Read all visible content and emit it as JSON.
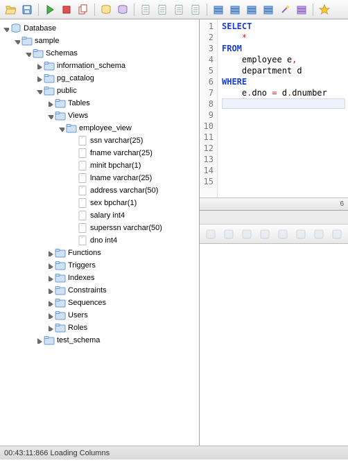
{
  "toolbar": {
    "icons": [
      "folder-open",
      "save",
      "sep",
      "run-green",
      "stop-red",
      "copy-red",
      "sep",
      "db-yellow",
      "db-purple",
      "sep",
      "page",
      "page-copy",
      "page-grid",
      "page-lines",
      "sep",
      "stack-blue",
      "menu-blue",
      "rows-blue",
      "rows-blue2",
      "wand",
      "rows-purple",
      "sep",
      "star"
    ]
  },
  "tree": [
    {
      "d": 0,
      "tw": "open",
      "ic": "db",
      "label": "Database"
    },
    {
      "d": 1,
      "tw": "open",
      "ic": "folder",
      "label": "sample"
    },
    {
      "d": 2,
      "tw": "open",
      "ic": "folder",
      "label": "Schemas"
    },
    {
      "d": 3,
      "tw": "closed",
      "ic": "folder",
      "label": "information_schema"
    },
    {
      "d": 3,
      "tw": "closed",
      "ic": "folder",
      "label": "pg_catalog"
    },
    {
      "d": 3,
      "tw": "open",
      "ic": "folder",
      "label": "public"
    },
    {
      "d": 4,
      "tw": "closed",
      "ic": "folder",
      "label": "Tables"
    },
    {
      "d": 4,
      "tw": "open",
      "ic": "folder",
      "label": "Views"
    },
    {
      "d": 5,
      "tw": "open",
      "ic": "folder",
      "label": "employee_view"
    },
    {
      "d": 6,
      "tw": "none",
      "ic": "col",
      "label": "ssn varchar(25)"
    },
    {
      "d": 6,
      "tw": "none",
      "ic": "col",
      "label": "fname varchar(25)"
    },
    {
      "d": 6,
      "tw": "none",
      "ic": "col",
      "label": "minit bpchar(1)"
    },
    {
      "d": 6,
      "tw": "none",
      "ic": "col",
      "label": "lname varchar(25)"
    },
    {
      "d": 6,
      "tw": "none",
      "ic": "col",
      "label": "address varchar(50)"
    },
    {
      "d": 6,
      "tw": "none",
      "ic": "col",
      "label": "sex bpchar(1)"
    },
    {
      "d": 6,
      "tw": "none",
      "ic": "col",
      "label": "salary int4"
    },
    {
      "d": 6,
      "tw": "none",
      "ic": "col",
      "label": "superssn varchar(50)"
    },
    {
      "d": 6,
      "tw": "none",
      "ic": "col",
      "label": "dno int4"
    },
    {
      "d": 4,
      "tw": "closed",
      "ic": "folder",
      "label": "Functions"
    },
    {
      "d": 4,
      "tw": "closed",
      "ic": "folder",
      "label": "Triggers"
    },
    {
      "d": 4,
      "tw": "closed",
      "ic": "folder",
      "label": "Indexes"
    },
    {
      "d": 4,
      "tw": "closed",
      "ic": "folder",
      "label": "Constraints"
    },
    {
      "d": 4,
      "tw": "closed",
      "ic": "folder",
      "label": "Sequences"
    },
    {
      "d": 4,
      "tw": "closed",
      "ic": "folder",
      "label": "Users"
    },
    {
      "d": 4,
      "tw": "closed",
      "ic": "folder",
      "label": "Roles"
    },
    {
      "d": 3,
      "tw": "closed",
      "ic": "folder",
      "label": "test_schema"
    }
  ],
  "sql": {
    "lines": [
      [
        {
          "t": "SELECT",
          "c": "kw"
        }
      ],
      [
        {
          "t": "    ",
          "c": "txt"
        },
        {
          "t": "*",
          "c": "op"
        }
      ],
      [
        {
          "t": "FROM",
          "c": "kw"
        }
      ],
      [
        {
          "t": "    employee e",
          "c": "txt"
        },
        {
          "t": ",",
          "c": "op"
        }
      ],
      [
        {
          "t": "    department d",
          "c": "txt"
        }
      ],
      [
        {
          "t": "WHERE",
          "c": "kw"
        }
      ],
      [
        {
          "t": "    e",
          "c": "txt"
        },
        {
          "t": ".",
          "c": "op"
        },
        {
          "t": "dno ",
          "c": "txt"
        },
        {
          "t": "=",
          "c": "op"
        },
        {
          "t": " d",
          "c": "txt"
        },
        {
          "t": ".",
          "c": "op"
        },
        {
          "t": "dnumber",
          "c": "txt"
        }
      ],
      [],
      [],
      [],
      [],
      [],
      [],
      [],
      []
    ],
    "gutter_count": 15,
    "scroll_hint": "6"
  },
  "results_toolbar": [
    "nav-first",
    "nav-prev",
    "list",
    "nav-next",
    "add-row",
    "remove-row",
    "copy",
    "filter"
  ],
  "status": "00:43:11:866 Loading Columns"
}
